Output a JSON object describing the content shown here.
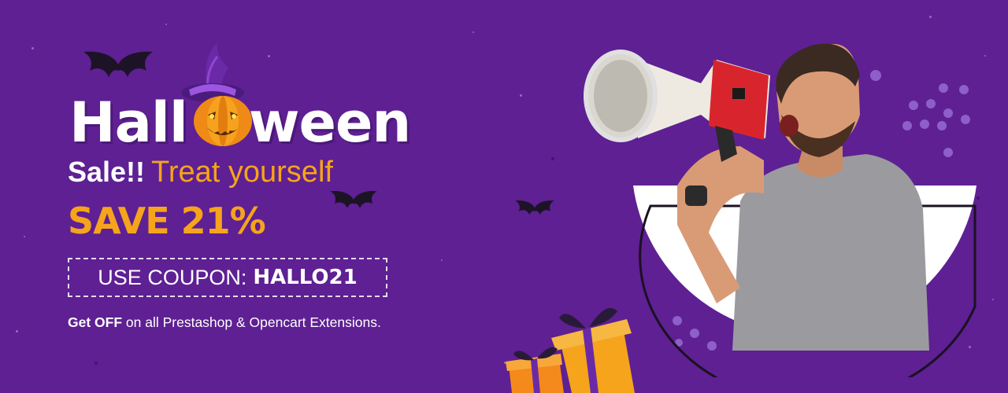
{
  "banner": {
    "title": {
      "prefix": "Hall",
      "suffix": "ween"
    },
    "tagline": {
      "strong": "Sale!!",
      "accent": "Treat yourself"
    },
    "save_text": "SAVE 21%",
    "coupon": {
      "label": "USE COUPON:",
      "code": "HALLO21"
    },
    "subline": {
      "strong": "Get OFF",
      "rest": "on all Prestashop & Opencart Extensions."
    }
  },
  "colors": {
    "background": "#5e2093",
    "accent": "#f5a41c",
    "text": "#ffffff"
  },
  "icons": [
    "bat-icon",
    "witch-hat-icon",
    "pumpkin-icon",
    "megaphone-icon",
    "gift-box-icon"
  ]
}
